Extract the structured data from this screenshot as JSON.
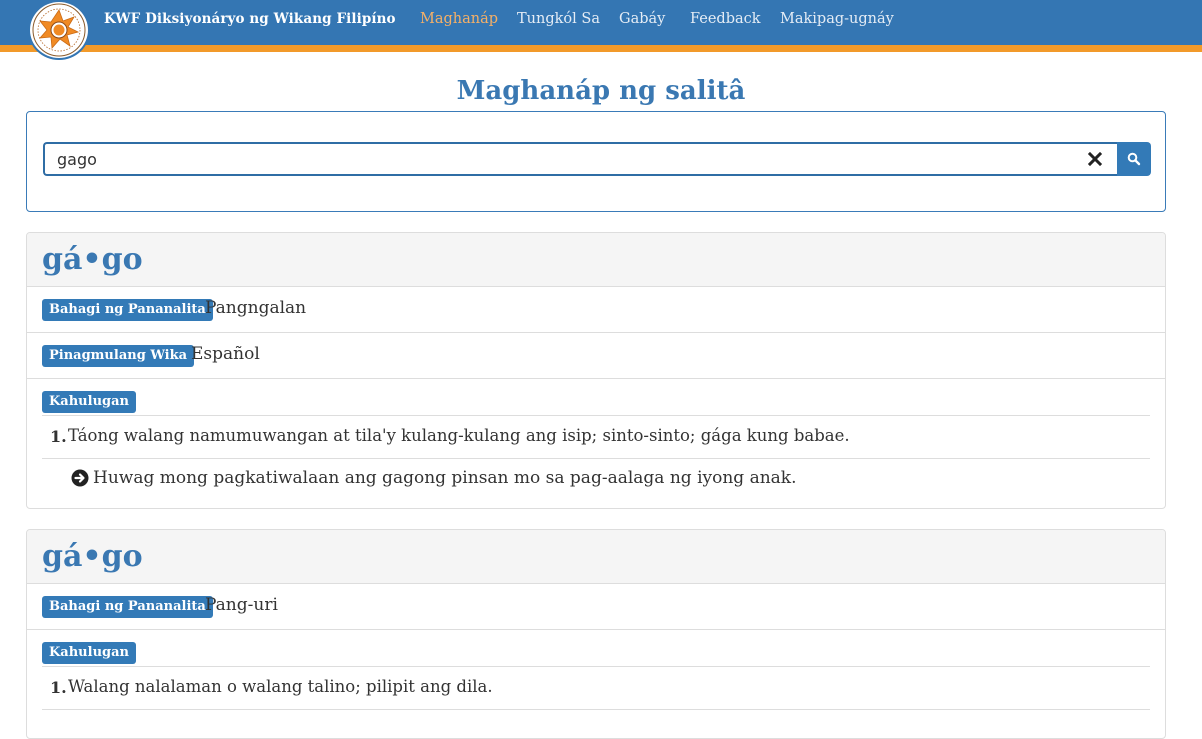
{
  "brand": {
    "title": "KWF Diksiyonáryo ng Wikang Filipíno"
  },
  "nav": {
    "items": [
      {
        "label": "Maghanáp",
        "active": true
      },
      {
        "label": "Tungkól Sa",
        "active": false
      },
      {
        "label": "Gabáy",
        "active": false
      },
      {
        "label": "Feedback",
        "active": false
      },
      {
        "label": "Makipag-ugnáy",
        "active": false
      }
    ]
  },
  "page": {
    "title": "Maghanáp ng salitâ"
  },
  "search": {
    "value": "gago",
    "clear_icon": "times-icon",
    "button_icon": "search-icon"
  },
  "entries": [
    {
      "headword": "gá•go",
      "pos_label": "Bahagi ng Pananalita",
      "pos_value": "Pangngalan",
      "origin_label": "Pinagmulang Wika",
      "origin_value": "Español",
      "meaning_label": "Kahulugan",
      "definitions": [
        {
          "number": "1.",
          "text": "Táong walang namumuwangan at tila'y kulang-kulang ang isip; sinto-sinto; gága kung babae.",
          "example": "Huwag mong pagkatiwalaan ang gagong pinsan mo sa pag-aalaga ng iyong anak."
        }
      ]
    },
    {
      "headword": "gá•go",
      "pos_label": "Bahagi ng Pananalita",
      "pos_value": "Pang-uri",
      "meaning_label": "Kahulugan",
      "definitions": [
        {
          "number": "1.",
          "text": "Walang nalalaman o walang talino; pilipit ang dila."
        }
      ]
    }
  ],
  "colors": {
    "navbar": "#3476b3",
    "stripe": "#f29a2a",
    "accent": "#337ab7",
    "active_nav": "#f5b067"
  }
}
